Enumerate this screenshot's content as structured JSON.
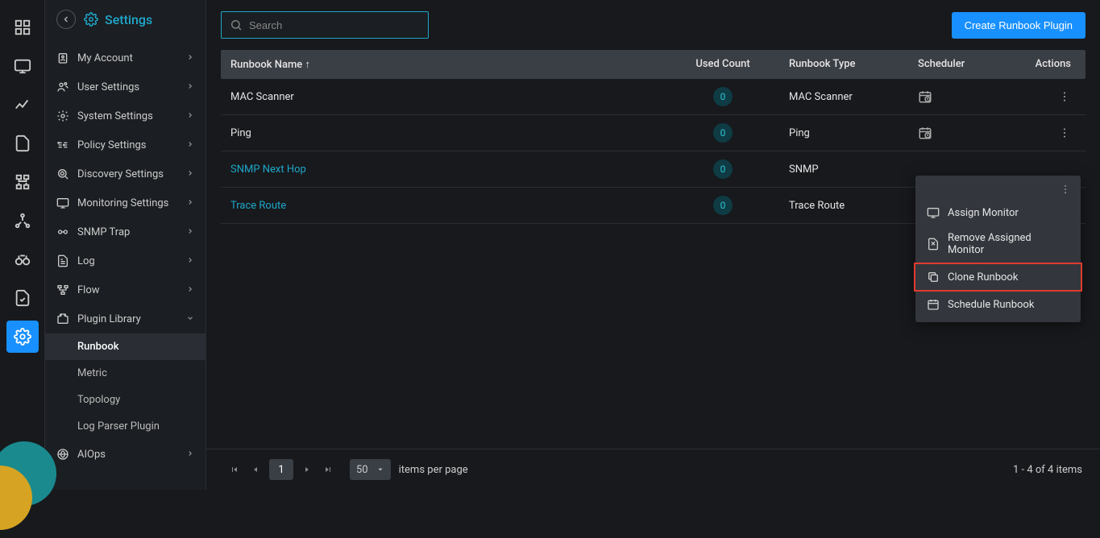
{
  "header": {
    "title": "Settings"
  },
  "sidebar": {
    "items": [
      {
        "label": "My Account"
      },
      {
        "label": "User Settings"
      },
      {
        "label": "System Settings"
      },
      {
        "label": "Policy Settings"
      },
      {
        "label": "Discovery Settings"
      },
      {
        "label": "Monitoring Settings"
      },
      {
        "label": "SNMP Trap"
      },
      {
        "label": "Log"
      },
      {
        "label": "Flow"
      },
      {
        "label": "Plugin Library",
        "expanded": true,
        "children": [
          {
            "label": "Runbook",
            "active": true
          },
          {
            "label": "Metric"
          },
          {
            "label": "Topology"
          },
          {
            "label": "Log Parser Plugin"
          }
        ]
      },
      {
        "label": "AIOps"
      }
    ]
  },
  "search": {
    "placeholder": "Search"
  },
  "toolbar": {
    "create_label": "Create Runbook Plugin"
  },
  "table": {
    "columns": {
      "name": "Runbook Name",
      "count": "Used Count",
      "type": "Runbook Type",
      "sched": "Scheduler",
      "actions": "Actions"
    },
    "sort_indicator": "↑",
    "rows": [
      {
        "name": "MAC Scanner",
        "count": "0",
        "type": "MAC Scanner",
        "link": false,
        "show_sched": true,
        "show_actions": true
      },
      {
        "name": "Ping",
        "count": "0",
        "type": "Ping",
        "link": false,
        "show_sched": true,
        "show_actions": true
      },
      {
        "name": "SNMP Next Hop",
        "count": "0",
        "type": "SNMP",
        "link": true,
        "show_sched": false,
        "show_actions": false
      },
      {
        "name": "Trace Route",
        "count": "0",
        "type": "Trace Route",
        "link": true,
        "show_sched": false,
        "show_actions": false
      }
    ]
  },
  "context_menu": {
    "items": [
      {
        "label": "Assign Monitor"
      },
      {
        "label": "Remove Assigned Monitor"
      },
      {
        "label": "Clone Runbook",
        "highlight": true
      },
      {
        "label": "Schedule Runbook"
      }
    ]
  },
  "pagination": {
    "page": "1",
    "page_size": "50",
    "items_per_page": "items per page",
    "status": "1 - 4 of 4 items"
  }
}
